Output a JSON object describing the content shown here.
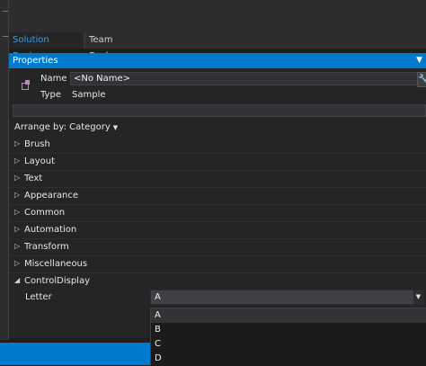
{
  "tabs": [
    {
      "label": "Solution Explorer",
      "active": true
    },
    {
      "label": "Team Explorer",
      "active": false
    }
  ],
  "properties_panel": {
    "title": "Properties",
    "name_label": "Name",
    "name_value": "<No Name>",
    "type_label": "Type",
    "type_value": "Sample",
    "search_value": "",
    "arrange_by": "Arrange by: Category",
    "categories": [
      {
        "label": "Brush",
        "expanded": false
      },
      {
        "label": "Layout",
        "expanded": false
      },
      {
        "label": "Text",
        "expanded": false
      },
      {
        "label": "Appearance",
        "expanded": false
      },
      {
        "label": "Common",
        "expanded": false
      },
      {
        "label": "Automation",
        "expanded": false
      },
      {
        "label": "Transform",
        "expanded": false
      },
      {
        "label": "Miscellaneous",
        "expanded": false
      },
      {
        "label": "ControlDisplay",
        "expanded": true
      }
    ],
    "letter_property": {
      "label": "Letter",
      "value": "A"
    }
  },
  "dropdown": {
    "options": [
      "A",
      "B",
      "C",
      "D"
    ],
    "selected": "A"
  },
  "icons": {
    "collapsed": "triangle-right",
    "expanded": "triangle-down-right",
    "wrench": "wrench",
    "element": "element"
  },
  "colors": {
    "accent": "#007acc",
    "background": "#1e1e1e",
    "panel": "#252526"
  }
}
